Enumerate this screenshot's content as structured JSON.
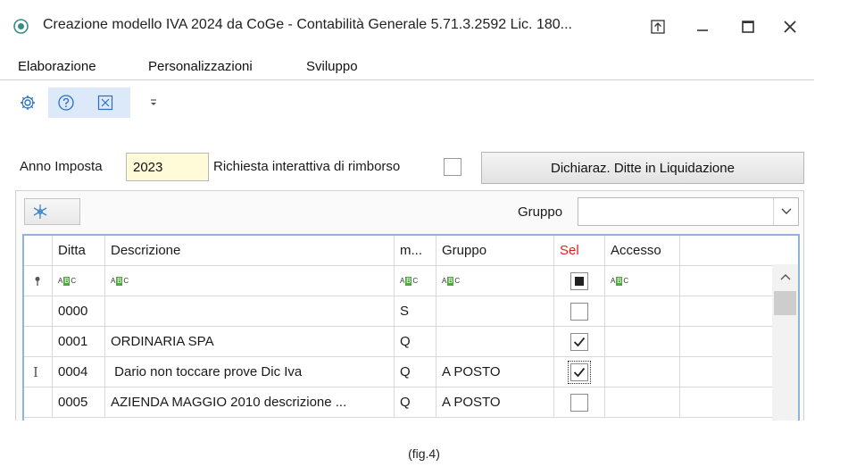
{
  "window": {
    "title": "Creazione modello IVA 2024 da CoGe - Contabilità Generale 5.71.3.2592 Lic. 180...",
    "icons": [
      "app-icon",
      "pin-icon",
      "minimize-icon",
      "maximize-icon",
      "close-icon"
    ]
  },
  "menu": {
    "items": [
      "Elaborazione",
      "Personalizzazioni",
      "Sviluppo"
    ]
  },
  "toolbar": {
    "icons": [
      "settings-icon",
      "help-icon",
      "close-x-icon",
      "overflow-icon"
    ]
  },
  "form": {
    "anno_label": "Anno Imposta",
    "anno_value": "2023",
    "rimborso_label": "Richiesta interattiva di rimborso",
    "rimborso_checked": false,
    "dich_button": "Dichiaraz. Ditte in Liquidazione",
    "gruppo_label": "Gruppo",
    "gruppo_value": ""
  },
  "grid": {
    "columns": [
      "Ditta",
      "Descrizione",
      "m...",
      "Gruppo",
      "Sel",
      "Accesso"
    ],
    "sel_color": "#e02020",
    "rows": [
      {
        "ditta": "0000",
        "descrizione": "",
        "m": "S",
        "gruppo": "",
        "sel": false,
        "marker": ""
      },
      {
        "ditta": "0001",
        "descrizione": "ORDINARIA SPA",
        "m": "Q",
        "gruppo": "",
        "sel": true,
        "marker": ""
      },
      {
        "ditta": "0004",
        "descrizione": " Dario non toccare prove Dic Iva",
        "m": "Q",
        "gruppo": "A POSTO",
        "sel": true,
        "marker": "I"
      },
      {
        "ditta": "0005",
        "descrizione": "AZIENDA MAGGIO 2010 descrizione ...",
        "m": "Q",
        "gruppo": "A POSTO",
        "sel": false,
        "marker": ""
      }
    ]
  },
  "caption": "(fig.4)"
}
